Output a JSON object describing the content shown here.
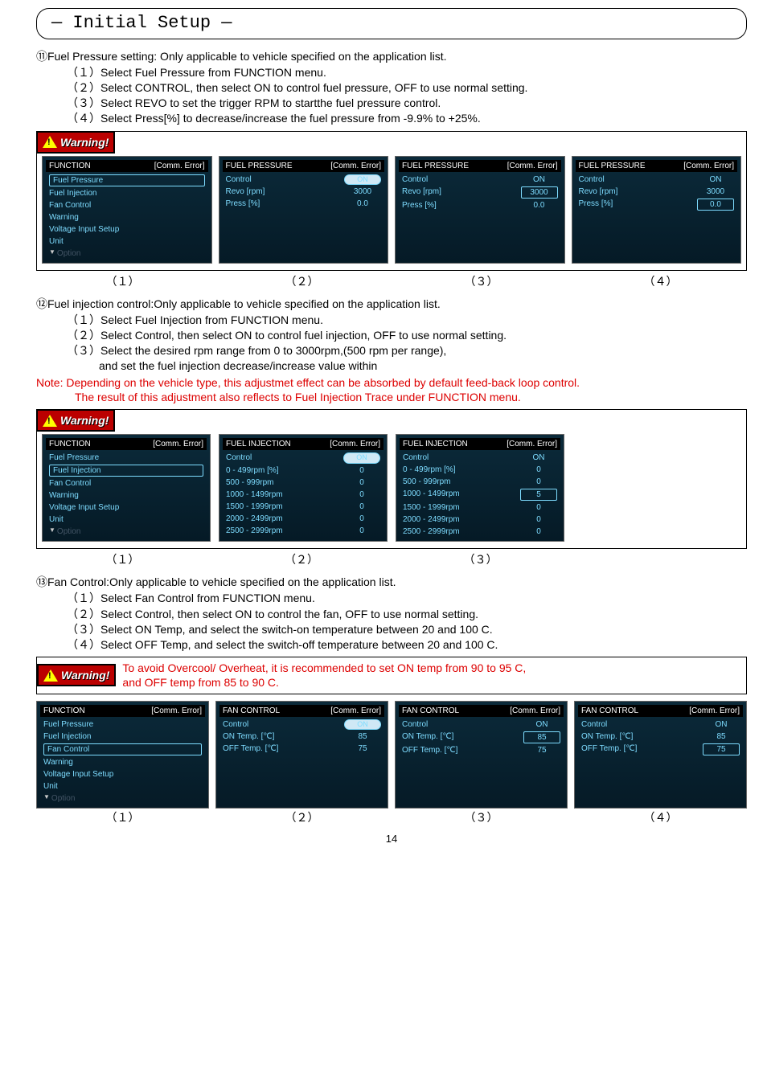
{
  "title": "— Initial Setup —",
  "s11": {
    "num": "⑪",
    "lead": "Fuel Pressure setting: Only applicable to vehicle specified on the application list.",
    "step1": "（１）Select Fuel Pressure from FUNCTION menu.",
    "step2": "（２）Select CONTROL, then select ON to control fuel pressure, OFF to use normal setting.",
    "step3": "（３）Select REVO to set the trigger RPM to startthe fuel pressure control.",
    "step4": "（４）Select Press[%] to decrease/increase the fuel pressure from -9.9% to +25%."
  },
  "warn": "Warning!",
  "comm": "[Comm. Error]",
  "func": {
    "title": "FUNCTION",
    "i1": "Fuel Pressure",
    "i2": "Fuel Injection",
    "i3": "Fan Control",
    "i4": "Warning",
    "i5": "Voltage Input Setup",
    "i6": "Unit",
    "i7": "Option"
  },
  "fp": {
    "title": "FUEL PRESSURE",
    "r1": "Control",
    "r2": "Revo [rpm]",
    "r3": "Press [%]",
    "on": "ON",
    "v2": "3000",
    "v3": "0.0"
  },
  "cap": {
    "c1": "（１）",
    "c2": "（２）",
    "c3": "（３）",
    "c4": "（４）"
  },
  "s12": {
    "num": "⑫",
    "lead": "Fuel injection control:Only applicable to vehicle specified on the application list.",
    "step1": "（１）Select Fuel Injection from FUNCTION menu.",
    "step2": "（２）Select Control, then select ON to control fuel injection, OFF to use normal setting.",
    "step3": "（３）Select the desired rpm range from 0 to 3000rpm,(500 rpm per range),",
    "step3b": "and set the fuel injection decrease/increase value within",
    "note1": "Note: Depending on the vehicle type, this adjustmet effect can be absorbed by default feed-back loop control.",
    "note2": "The result of this adjustment also reflects to Fuel Injection Trace under FUNCTION menu."
  },
  "fi": {
    "title": "FUEL INJECTION",
    "r1": "Control",
    "r2": "0 - 499rpm [%]",
    "r3": "500 - 999rpm",
    "r4": "1000 - 1499rpm",
    "r5": "1500 - 1999rpm",
    "r6": "2000 - 2499rpm",
    "r7": "2500 - 2999rpm",
    "on": "ON",
    "z": "0",
    "five": "5"
  },
  "s13": {
    "num": "⑬",
    "lead": "Fan Control:Only applicable to vehicle specified on the application list.",
    "step1": "（１）Select Fan Control from FUNCTION menu.",
    "step2": "（２）Select Control, then select ON to control the fan, OFF to use normal setting.",
    "step3": "（３）Select ON Temp, and select the switch-on temperature between 20 and 100 C.",
    "step4": "（４）Select OFF Temp, and select the switch-off temperature between 20 and 100 C.",
    "warnnote1": "To avoid Overcool/ Overheat, it is recommended to set ON temp from 90 to 95 C,",
    "warnnote2": "and OFF temp from 85 to 90 C."
  },
  "fc": {
    "title": "FAN CONTROL",
    "r1": "Control",
    "r2": "ON Temp.  [℃]",
    "r3": "OFF Temp. [℃]",
    "on": "ON",
    "v2": "85",
    "v3": "75"
  },
  "pagenum": "14"
}
